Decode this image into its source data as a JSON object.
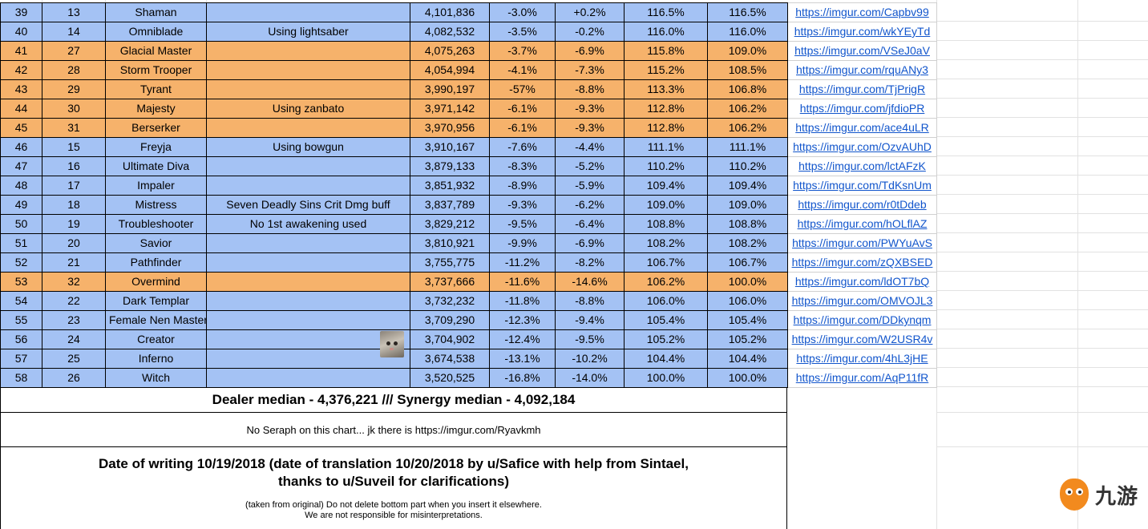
{
  "rows": [
    {
      "rank": "39",
      "num": "13",
      "cls": "Shaman",
      "note": "",
      "score": "4,101,836",
      "p1": "-3.0%",
      "p2": "+0.2%",
      "r1": "116.5%",
      "r2": "116.5%",
      "link": "https://imgur.com/Capbv99",
      "color": "blue"
    },
    {
      "rank": "40",
      "num": "14",
      "cls": "Omniblade",
      "note": "Using lightsaber",
      "score": "4,082,532",
      "p1": "-3.5%",
      "p2": "-0.2%",
      "r1": "116.0%",
      "r2": "116.0%",
      "link": "https://imgur.com/wkYEyTd",
      "color": "blue"
    },
    {
      "rank": "41",
      "num": "27",
      "cls": "Glacial Master",
      "note": "",
      "score": "4,075,263",
      "p1": "-3.7%",
      "p2": "-6.9%",
      "r1": "115.8%",
      "r2": "109.0%",
      "link": "https://imgur.com/VSeJ0aV",
      "color": "orange"
    },
    {
      "rank": "42",
      "num": "28",
      "cls": "Storm Trooper",
      "note": "",
      "score": "4,054,994",
      "p1": "-4.1%",
      "p2": "-7.3%",
      "r1": "115.2%",
      "r2": "108.5%",
      "link": "https://imgur.com/rquANy3",
      "color": "orange"
    },
    {
      "rank": "43",
      "num": "29",
      "cls": "Tyrant",
      "note": "",
      "score": "3,990,197",
      "p1": "-57%",
      "p2": "-8.8%",
      "r1": "113.3%",
      "r2": "106.8%",
      "link": "https://imgur.com/TjPrigR",
      "color": "orange"
    },
    {
      "rank": "44",
      "num": "30",
      "cls": "Majesty",
      "note": "Using zanbato",
      "score": "3,971,142",
      "p1": "-6.1%",
      "p2": "-9.3%",
      "r1": "112.8%",
      "r2": "106.2%",
      "link": "https://imgur.com/jfdioPR",
      "color": "orange"
    },
    {
      "rank": "45",
      "num": "31",
      "cls": "Berserker",
      "note": "",
      "score": "3,970,956",
      "p1": "-6.1%",
      "p2": "-9.3%",
      "r1": "112.8%",
      "r2": "106.2%",
      "link": "https://imgur.com/ace4uLR",
      "color": "orange"
    },
    {
      "rank": "46",
      "num": "15",
      "cls": "Freyja",
      "note": "Using bowgun",
      "score": "3,910,167",
      "p1": "-7.6%",
      "p2": "-4.4%",
      "r1": "111.1%",
      "r2": "111.1%",
      "link": "https://imgur.com/OzvAUhD",
      "color": "blue"
    },
    {
      "rank": "47",
      "num": "16",
      "cls": "Ultimate Diva",
      "note": "",
      "score": "3,879,133",
      "p1": "-8.3%",
      "p2": "-5.2%",
      "r1": "110.2%",
      "r2": "110.2%",
      "link": "https://imgur.com/lctAFzK",
      "color": "blue"
    },
    {
      "rank": "48",
      "num": "17",
      "cls": "Impaler",
      "note": "",
      "score": "3,851,932",
      "p1": "-8.9%",
      "p2": "-5.9%",
      "r1": "109.4%",
      "r2": "109.4%",
      "link": "https://imgur.com/TdKsnUm",
      "color": "blue"
    },
    {
      "rank": "49",
      "num": "18",
      "cls": "Mistress",
      "note": "Seven Deadly Sins Crit Dmg buff",
      "score": "3,837,789",
      "p1": "-9.3%",
      "p2": "-6.2%",
      "r1": "109.0%",
      "r2": "109.0%",
      "link": "https://imgur.com/r0tDdeb",
      "color": "blue"
    },
    {
      "rank": "50",
      "num": "19",
      "cls": "Troubleshooter",
      "note": "No 1st awakening used",
      "score": "3,829,212",
      "p1": "-9.5%",
      "p2": "-6.4%",
      "r1": "108.8%",
      "r2": "108.8%",
      "link": "https://imgur.com/hOLflAZ",
      "color": "blue"
    },
    {
      "rank": "51",
      "num": "20",
      "cls": "Savior",
      "note": "",
      "score": "3,810,921",
      "p1": "-9.9%",
      "p2": "-6.9%",
      "r1": "108.2%",
      "r2": "108.2%",
      "link": "https://imgur.com/PWYuAvS",
      "color": "blue"
    },
    {
      "rank": "52",
      "num": "21",
      "cls": "Pathfinder",
      "note": "",
      "score": "3,755,775",
      "p1": "-11.2%",
      "p2": "-8.2%",
      "r1": "106.7%",
      "r2": "106.7%",
      "link": "https://imgur.com/zQXBSED",
      "color": "blue"
    },
    {
      "rank": "53",
      "num": "32",
      "cls": "Overmind",
      "note": "",
      "score": "3,737,666",
      "p1": "-11.6%",
      "p2": "-14.6%",
      "r1": "106.2%",
      "r2": "100.0%",
      "link": "https://imgur.com/ldOT7bQ",
      "color": "orange"
    },
    {
      "rank": "54",
      "num": "22",
      "cls": "Dark Templar",
      "note": "",
      "score": "3,732,232",
      "p1": "-11.8%",
      "p2": "-8.8%",
      "r1": "106.0%",
      "r2": "106.0%",
      "link": "https://imgur.com/OMVOJL3",
      "color": "blue"
    },
    {
      "rank": "55",
      "num": "23",
      "cls": "Female Nen Master",
      "note": "",
      "score": "3,709,290",
      "p1": "-12.3%",
      "p2": "-9.4%",
      "r1": "105.4%",
      "r2": "105.4%",
      "link": "https://imgur.com/DDkynqm",
      "color": "blue"
    },
    {
      "rank": "56",
      "num": "24",
      "cls": "Creator",
      "note": "",
      "score": "3,704,902",
      "p1": "-12.4%",
      "p2": "-9.5%",
      "r1": "105.2%",
      "r2": "105.2%",
      "link": "https://imgur.com/W2USR4v",
      "color": "blue"
    },
    {
      "rank": "57",
      "num": "25",
      "cls": "Inferno",
      "note": "",
      "score": "3,674,538",
      "p1": "-13.1%",
      "p2": "-10.2%",
      "r1": "104.4%",
      "r2": "104.4%",
      "link": "https://imgur.com/4hL3jHE",
      "color": "blue"
    },
    {
      "rank": "58",
      "num": "26",
      "cls": "Witch",
      "note": "",
      "score": "3,520,525",
      "p1": "-16.8%",
      "p2": "-14.0%",
      "r1": "100.0%",
      "r2": "100.0%",
      "link": "https://imgur.com/AqP11fR",
      "color": "blue"
    }
  ],
  "median_text": "Dealer median - 4,376,221 /// Synergy median - 4,092,184",
  "seraph_text": "No Seraph on this chart... jk there is https://imgur.com/Ryavkmh",
  "date_line1": "Date of writing 10/19/2018 (date of translation 10/20/2018 by u/Safice with help from Sintael,",
  "date_line2": "thanks to u/Suveil for clarifications)",
  "note_line1": "(taken from original) Do not delete bottom part when you insert it elsewhere.",
  "note_line2": "We are not responsible for misinterpretations.",
  "watermark_text": "九游",
  "colors": {
    "blue": "#a4c2f4",
    "orange": "#f6b26b",
    "link": "#1155cc"
  }
}
